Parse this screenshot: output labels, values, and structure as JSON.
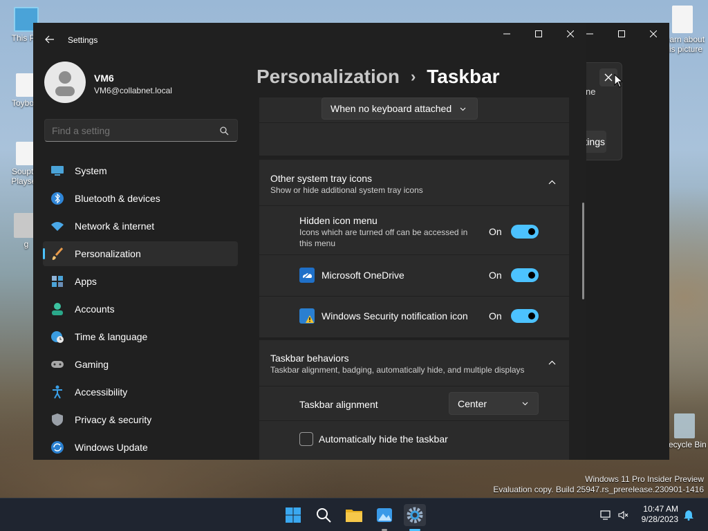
{
  "desktop": {
    "icons_left": [
      {
        "label": "This PC",
        "name": "desktop-icon-this-pc"
      },
      {
        "label": "Toybox",
        "name": "desktop-icon-toybox"
      },
      {
        "label": "Soupto Playset",
        "name": "desktop-icon-soupto"
      },
      {
        "label": "g",
        "name": "desktop-icon-settings-shortcut"
      }
    ],
    "icons_right": [
      {
        "label": "Learn about this picture",
        "name": "desktop-icon-learn-picture"
      },
      {
        "label": "Recycle Bin",
        "name": "desktop-icon-recycle-bin"
      }
    ],
    "watermark": {
      "line1": "Windows 11 Pro Insider Preview",
      "line2": "Evaluation copy. Build 25947.rs_prerelease.230901-1416"
    }
  },
  "background_window": {
    "dialog_text_fragment": "ne",
    "button_fragment": "tings"
  },
  "settings": {
    "window_title": "Settings",
    "user": {
      "name": "VM6",
      "email": "VM6@collabnet.local"
    },
    "search": {
      "placeholder": "Find a setting"
    },
    "nav": [
      {
        "label": "System",
        "icon": "monitor-icon"
      },
      {
        "label": "Bluetooth & devices",
        "icon": "bluetooth-icon"
      },
      {
        "label": "Network & internet",
        "icon": "wifi-icon"
      },
      {
        "label": "Personalization",
        "icon": "brush-icon",
        "selected": true
      },
      {
        "label": "Apps",
        "icon": "apps-icon"
      },
      {
        "label": "Accounts",
        "icon": "person-icon"
      },
      {
        "label": "Time & language",
        "icon": "globe-clock-icon"
      },
      {
        "label": "Gaming",
        "icon": "gamepad-icon"
      },
      {
        "label": "Accessibility",
        "icon": "accessibility-icon"
      },
      {
        "label": "Privacy & security",
        "icon": "shield-icon"
      },
      {
        "label": "Windows Update",
        "icon": "update-icon"
      }
    ],
    "breadcrumb": {
      "parent": "Personalization",
      "separator": "›",
      "current": "Taskbar"
    },
    "pen_menu_dropdown": {
      "value": "When no keyboard attached"
    },
    "tray_section": {
      "title": "Other system tray icons",
      "subtitle": "Show or hide additional system tray icons",
      "items": [
        {
          "title": "Hidden icon menu",
          "subtitle": "Icons which are turned off can be accessed in this menu",
          "state": "On"
        },
        {
          "title": "Microsoft OneDrive",
          "state": "On",
          "icon": "onedrive-icon"
        },
        {
          "title": "Windows Security notification icon",
          "state": "On",
          "icon": "security-warning-icon"
        }
      ]
    },
    "behaviors_section": {
      "title": "Taskbar behaviors",
      "subtitle": "Taskbar alignment, badging, automatically hide, and multiple displays",
      "alignment_label": "Taskbar alignment",
      "alignment_value": "Center",
      "autohide_label": "Automatically hide the taskbar"
    }
  },
  "taskbar": {
    "apps": [
      "start-icon",
      "search-icon",
      "file-explorer-icon",
      "photos-icon",
      "settings-gear-icon"
    ],
    "time": "10:47 AM",
    "date": "9/28/2023"
  },
  "colors": {
    "accent": "#4cc2ff",
    "window_bg": "#202020",
    "card_bg": "#2b2b2b"
  }
}
